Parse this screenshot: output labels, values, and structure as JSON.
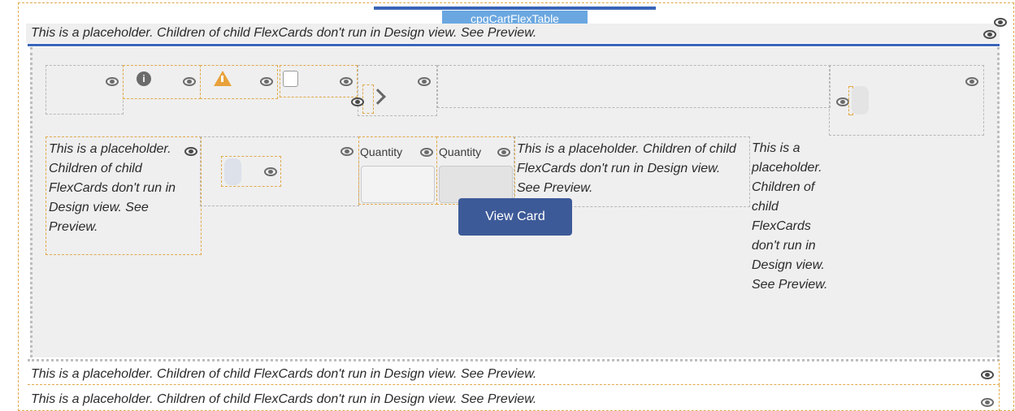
{
  "component_label": "cpqCartFlexTable",
  "placeholder_text": "This is a placeholder. Children of child FlexCards don't run in Design view. See Preview.",
  "quantity_label": "Quantity",
  "view_card_button": "View Card",
  "icons": {
    "visibility": "eye-icon",
    "info": "info-icon",
    "warning": "warning-icon",
    "checkbox": "checkbox-icon",
    "chevron": "chevron-right-icon"
  },
  "colors": {
    "accent_blue": "#3a65b8",
    "button_blue": "#3d5a98",
    "tag_blue": "#6aa7e0",
    "warning_orange": "#e8a23b",
    "dashed_orange": "#e0a94a",
    "panel_bg": "#efefef"
  }
}
